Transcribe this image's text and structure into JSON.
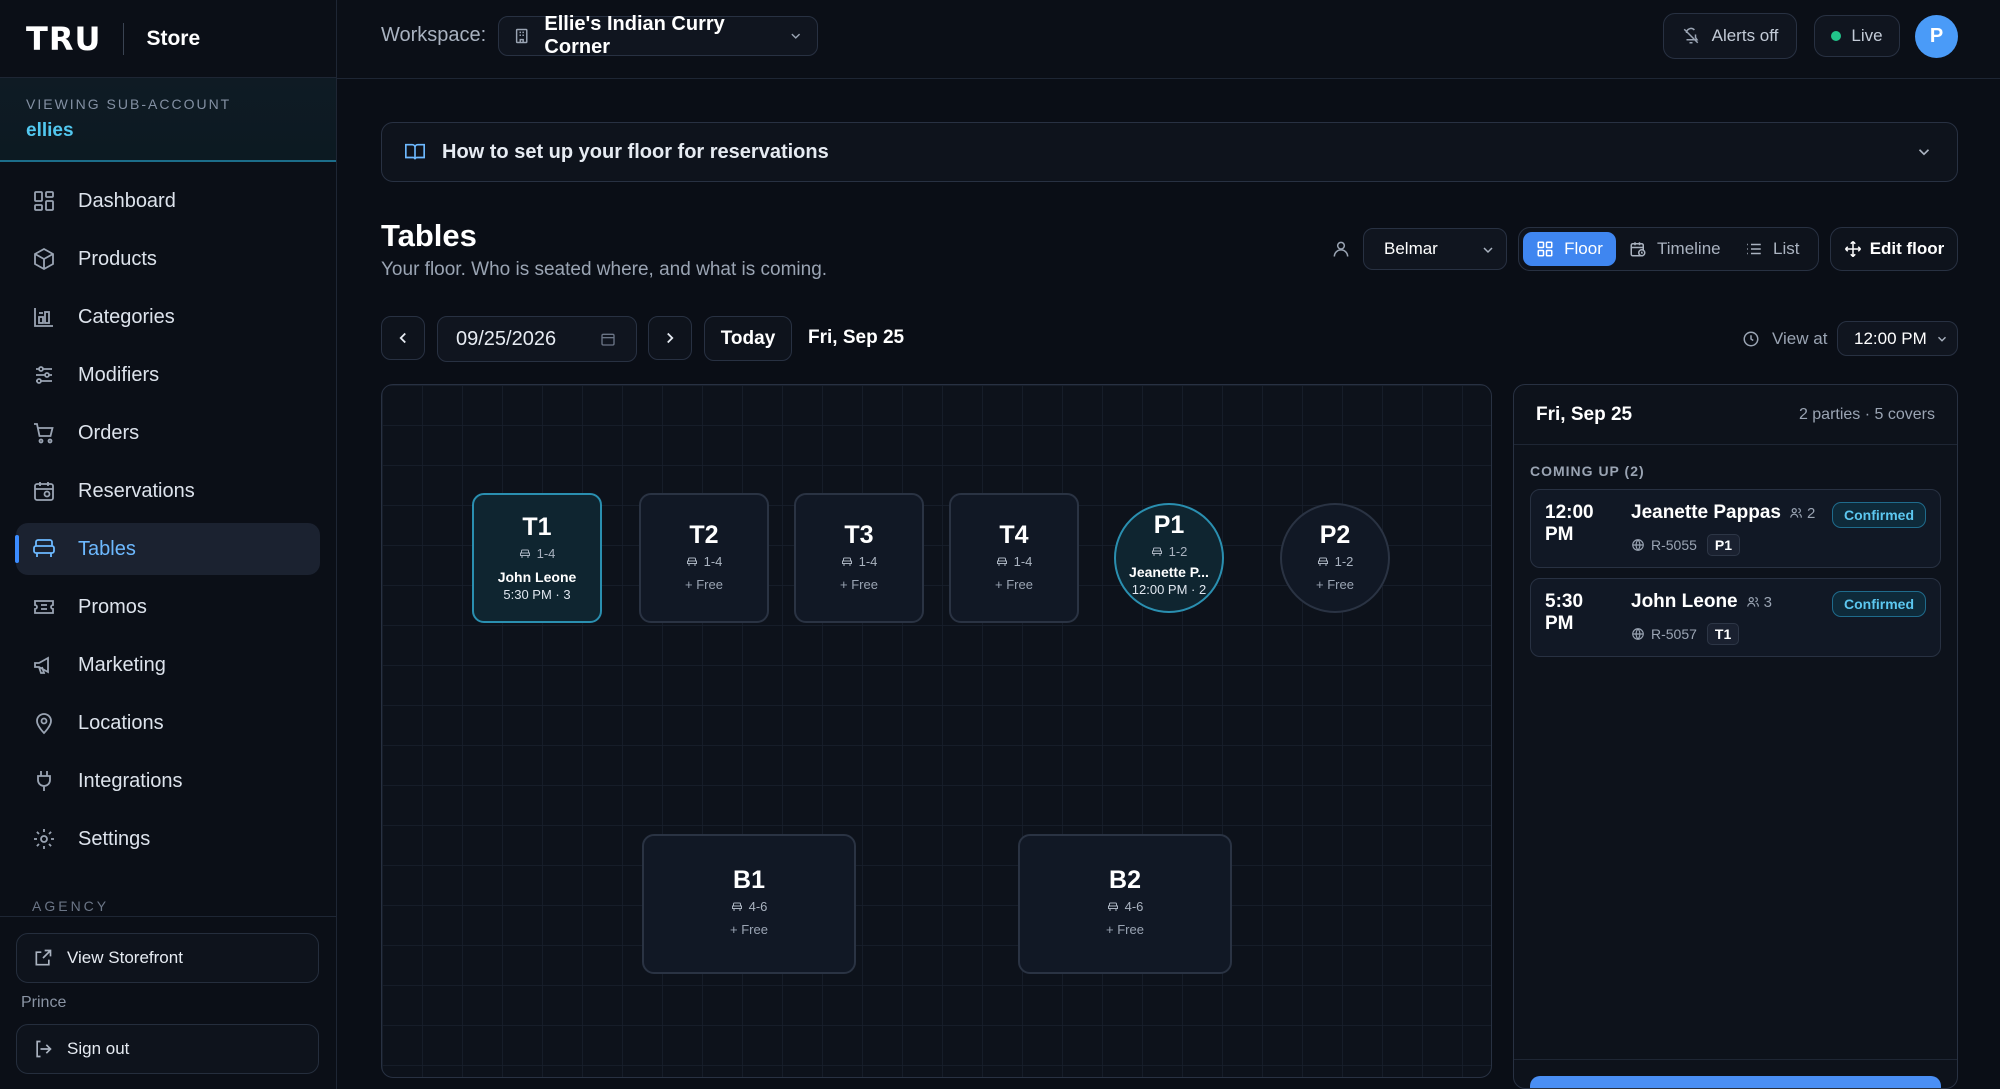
{
  "brand": {
    "logo": "TRU",
    "store": "Store"
  },
  "subaccount": {
    "label": "VIEWING SUB-ACCOUNT",
    "name": "ellies"
  },
  "nav": {
    "items": [
      {
        "label": "Dashboard",
        "icon": "dashboard-icon"
      },
      {
        "label": "Products",
        "icon": "box-icon"
      },
      {
        "label": "Categories",
        "icon": "categories-icon"
      },
      {
        "label": "Modifiers",
        "icon": "sliders-icon"
      },
      {
        "label": "Orders",
        "icon": "cart-icon"
      },
      {
        "label": "Reservations",
        "icon": "calendar-icon"
      },
      {
        "label": "Tables",
        "icon": "table-icon",
        "active": true
      },
      {
        "label": "Promos",
        "icon": "ticket-icon"
      },
      {
        "label": "Marketing",
        "icon": "megaphone-icon"
      },
      {
        "label": "Locations",
        "icon": "map-pin-icon"
      },
      {
        "label": "Integrations",
        "icon": "plug-icon"
      },
      {
        "label": "Settings",
        "icon": "gear-icon"
      }
    ],
    "agency_label": "AGENCY",
    "view_storefront": "View Storefront",
    "user": "Prince",
    "sign_out": "Sign out"
  },
  "topbar": {
    "workspace_label": "Workspace:",
    "workspace": "Ellie's Indian Curry Corner",
    "alerts": "Alerts off",
    "live": "Live",
    "avatar": "P",
    "live_color": "#22c58b",
    "accent": "#3f86f0"
  },
  "guide": {
    "text": "How to set up your floor for reservations"
  },
  "page": {
    "title": "Tables",
    "subtitle": "Your floor. Who is seated where, and what is coming.",
    "location": "Belmar",
    "views": {
      "floor": "Floor",
      "timeline": "Timeline",
      "list": "List",
      "active": "Floor"
    },
    "edit_floor": "Edit floor"
  },
  "datebar": {
    "date": "09/25/2026",
    "today": "Today",
    "date_label": "Fri, Sep 25",
    "view_at": "View at",
    "time": "12:00 PM"
  },
  "tables": {
    "T1": {
      "name": "T1",
      "cap": "1-4",
      "guest": "John Leone",
      "detail": "5:30 PM · 3"
    },
    "T2": {
      "name": "T2",
      "cap": "1-4",
      "free": "+ Free"
    },
    "T3": {
      "name": "T3",
      "cap": "1-4",
      "free": "+ Free"
    },
    "T4": {
      "name": "T4",
      "cap": "1-4",
      "free": "+ Free"
    },
    "P1": {
      "name": "P1",
      "cap": "1-2",
      "guest": "Jeanette P...",
      "detail": "12:00 PM · 2"
    },
    "P2": {
      "name": "P2",
      "cap": "1-2",
      "free": "+ Free"
    },
    "B1": {
      "name": "B1",
      "cap": "4-6",
      "free": "+ Free"
    },
    "B2": {
      "name": "B2",
      "cap": "4-6",
      "free": "+ Free"
    }
  },
  "panel": {
    "date": "Fri, Sep 25",
    "summary": "2 parties · 5 covers",
    "coming_up": "COMING UP (2)",
    "reservations": [
      {
        "time": "12:00 PM",
        "name": "Jeanette Pappas",
        "covers": "2",
        "ref": "R-5055",
        "table": "P1",
        "status": "Confirmed"
      },
      {
        "time": "5:30 PM",
        "name": "John Leone",
        "covers": "3",
        "ref": "R-5057",
        "table": "T1",
        "status": "Confirmed"
      }
    ]
  }
}
